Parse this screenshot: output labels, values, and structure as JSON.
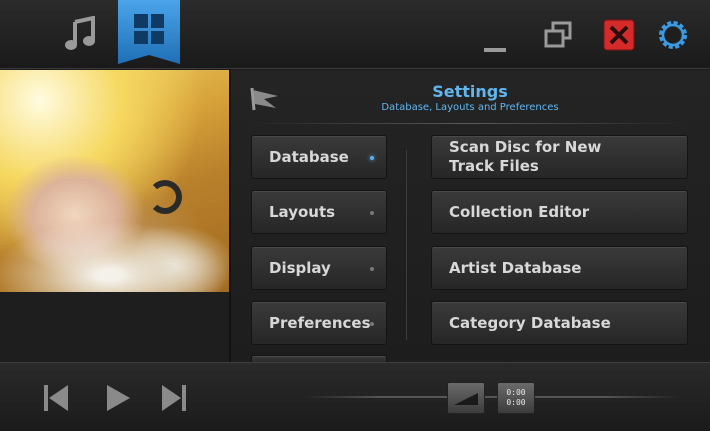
{
  "settings": {
    "title": "Settings",
    "subtitle": "Database, Layouts and Preferences"
  },
  "categories": [
    {
      "label": "Database",
      "active": true
    },
    {
      "label": "Layouts",
      "active": false
    },
    {
      "label": "Display",
      "active": false
    },
    {
      "label": "Preferences",
      "active": false
    }
  ],
  "actions": [
    {
      "label": "Scan Disc for New Track Files"
    },
    {
      "label": "Collection Editor"
    },
    {
      "label": "Artist Database"
    },
    {
      "label": "Category Database"
    }
  ],
  "player": {
    "time_elapsed": "0:00",
    "time_total": "0:00"
  },
  "icons": {
    "music": "music-note-icon",
    "home": "windows-grid-icon",
    "minimize": "minimize-icon",
    "restore": "restore-icon",
    "close": "close-icon",
    "settings": "gear-icon"
  },
  "colors": {
    "accent": "#62b6f0",
    "close": "#d42a2a",
    "ribbon": "#2a86d0"
  }
}
